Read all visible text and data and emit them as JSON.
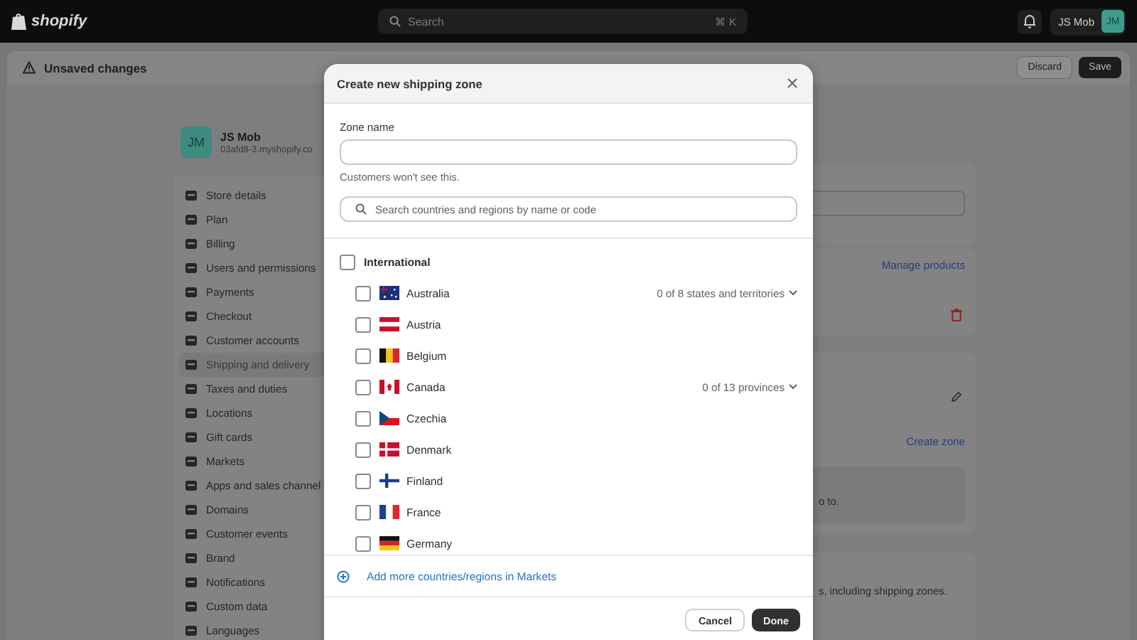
{
  "top_bar": {
    "logo": "shopify",
    "search": {
      "placeholder": "Search",
      "shortcut": "⌘ K"
    },
    "account": {
      "name": "JS Mob",
      "initials": "JM"
    }
  },
  "unsaved_bar": {
    "title": "Unsaved changes",
    "buttons": [
      {
        "label": "Discard",
        "kind": "secondary"
      },
      {
        "label": "Save",
        "kind": "primary"
      }
    ]
  },
  "store": {
    "initials": "JM",
    "name": "JS Mob",
    "domain": "03afd8-3.myshopify.co"
  },
  "sidebar": {
    "items": [
      {
        "label": "Store details",
        "selected": false
      },
      {
        "label": "Plan",
        "selected": false
      },
      {
        "label": "Billing",
        "selected": false
      },
      {
        "label": "Users and permissions",
        "selected": false
      },
      {
        "label": "Payments",
        "selected": false
      },
      {
        "label": "Checkout",
        "selected": false
      },
      {
        "label": "Customer accounts",
        "selected": false
      },
      {
        "label": "Shipping and delivery",
        "selected": true
      },
      {
        "label": "Taxes and duties",
        "selected": false
      },
      {
        "label": "Locations",
        "selected": false
      },
      {
        "label": "Gift cards",
        "selected": false
      },
      {
        "label": "Markets",
        "selected": false
      },
      {
        "label": "Apps and sales channel",
        "selected": false
      },
      {
        "label": "Domains",
        "selected": false
      },
      {
        "label": "Customer events",
        "selected": false
      },
      {
        "label": "Brand",
        "selected": false
      },
      {
        "label": "Notifications",
        "selected": false
      },
      {
        "label": "Custom data",
        "selected": false
      },
      {
        "label": "Languages",
        "selected": false
      }
    ]
  },
  "cards": {
    "manage_link": "Manage products",
    "create_link": "Create zone",
    "note_fragment": "o to.",
    "description_fragment": "s, including shipping zones."
  },
  "modal": {
    "title": "Create new shipping zone",
    "zone_name": {
      "label": "Zone name",
      "help": "Customers won't see this."
    },
    "search": {
      "placeholder": "Search countries and regions by name or code"
    },
    "group": {
      "label": "International",
      "checked": false
    },
    "countries": [
      {
        "name": "Australia",
        "kind": "au",
        "checked": false,
        "regions": "0 of 8 states and territories"
      },
      {
        "name": "Austria",
        "kind": "at",
        "checked": false
      },
      {
        "name": "Belgium",
        "kind": "be",
        "checked": false
      },
      {
        "name": "Canada",
        "kind": "ca",
        "checked": false,
        "regions": "0 of 13 provinces"
      },
      {
        "name": "Czechia",
        "kind": "cz",
        "checked": false
      },
      {
        "name": "Denmark",
        "kind": "dk",
        "checked": false
      },
      {
        "name": "Finland",
        "kind": "fi",
        "checked": false
      },
      {
        "name": "France",
        "kind": "fr",
        "checked": false
      },
      {
        "name": "Germany",
        "kind": "de",
        "checked": false
      }
    ],
    "add_link": "Add more countries/regions in Markets",
    "buttons": [
      {
        "label": "Cancel",
        "kind": "secondary"
      },
      {
        "label": "Done",
        "kind": "primary"
      }
    ]
  }
}
